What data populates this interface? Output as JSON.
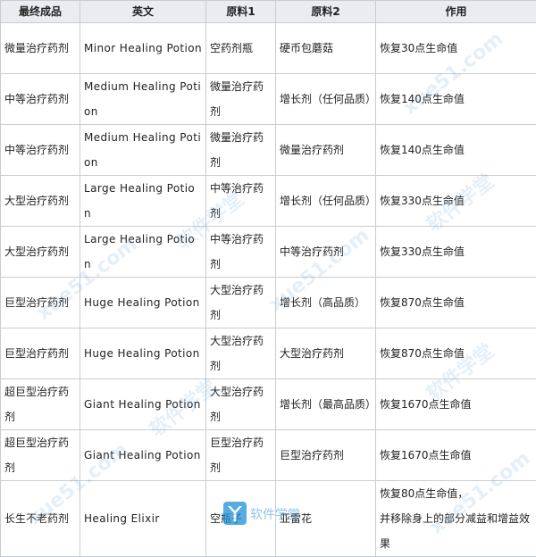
{
  "headers": [
    "最终成品",
    "英文",
    "原料1",
    "原料2",
    "作用"
  ],
  "rows": [
    {
      "product": "微量治疗药剂",
      "english": "Minor Healing Potion",
      "material1": "空药剂瓶",
      "material2": "硬币包蘑菇",
      "effect": [
        "恢复30点生命值"
      ]
    },
    {
      "product": "中等治疗药剂",
      "english": "Medium Healing Potion",
      "material1": "微量治疗药剂",
      "material2": "增长剂（任何品质）",
      "effect": [
        "恢复140点生命值"
      ]
    },
    {
      "product": "中等治疗药剂",
      "english": "Medium Healing Potion",
      "material1": "微量治疗药剂",
      "material2": "微量治疗药剂",
      "effect": [
        "恢复140点生命值"
      ]
    },
    {
      "product": "大型治疗药剂",
      "english": "Large Healing Potion",
      "material1": "中等治疗药剂",
      "material2": "增长剂（任何品质）",
      "effect": [
        "恢复330点生命值"
      ]
    },
    {
      "product": "大型治疗药剂",
      "english": "Large Healing Potion",
      "material1": "中等治疗药剂",
      "material2": "中等治疗药剂",
      "effect": [
        "恢复330点生命值"
      ]
    },
    {
      "product": "巨型治疗药剂",
      "english": "Huge Healing Potion",
      "material1": "大型治疗药剂",
      "material2": "增长剂（高品质）",
      "effect": [
        "恢复870点生命值"
      ]
    },
    {
      "product": "巨型治疗药剂",
      "english": "Huge Healing Potion",
      "material1": "大型治疗药剂",
      "material2": "大型治疗药剂",
      "effect": [
        "恢复870点生命值"
      ]
    },
    {
      "product": "超巨型治疗药剂",
      "english": "Giant Healing Potion",
      "material1": "大型治疗药剂",
      "material2": "增长剂（最高品质）",
      "effect": [
        "恢复1670点生命值"
      ]
    },
    {
      "product": "超巨型治疗药剂",
      "english": "Giant Healing Potion",
      "material1": "巨型治疗药剂",
      "material2": "巨型治疗药剂",
      "effect": [
        "恢复1670点生命值"
      ]
    },
    {
      "product": "长生不老药剂",
      "english": "Healing Elixir",
      "material1": "空瓶子",
      "material2": "亚雷花",
      "effect": [
        "恢复80点生命值，",
        "并移除身上的部分减益和增益效果"
      ]
    }
  ],
  "watermark": {
    "text": "软件学堂",
    "url": "xue51.com",
    "logo_text": "软件学堂"
  }
}
